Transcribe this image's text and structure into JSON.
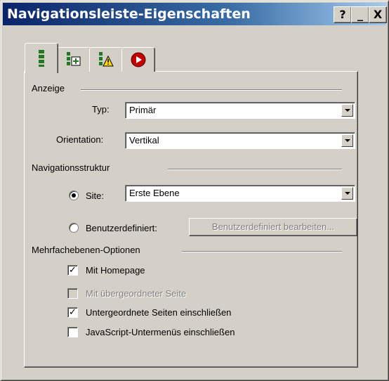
{
  "window": {
    "title": "Navigationsleiste-Eigenschaften",
    "buttons": {
      "help": "?",
      "minimize": "_",
      "close": "X"
    }
  },
  "tabs": [
    {
      "icon": "nav-bar-icon",
      "active": true
    },
    {
      "icon": "add-page-icon",
      "active": false
    },
    {
      "icon": "warning-page-icon",
      "active": false
    },
    {
      "icon": "red-circle-icon",
      "active": false
    }
  ],
  "anzeige": {
    "group_label": "Anzeige",
    "typ_label": "Typ:",
    "typ_value": "Primär",
    "orientation_label": "Orientation:",
    "orientation_value": "Vertikal"
  },
  "navigationsstruktur": {
    "group_label": "Navigationsstruktur",
    "site_label": "Site:",
    "site_value": "Erste Ebene",
    "custom_label": "Benutzerdefiniert:",
    "custom_button": "Benutzerdefiniert bearbeiten..."
  },
  "mehrfachebenen": {
    "group_label": "Mehrfachebenen-Optionen",
    "options": [
      {
        "label": "Mit Homepage",
        "checked": true,
        "enabled": true
      },
      {
        "label": "Mit übergeordneter Seite",
        "checked": false,
        "enabled": false
      },
      {
        "label": "Untergeordnete Seiten einschließen",
        "checked": true,
        "enabled": true
      },
      {
        "label": "JavaScript-Untermenüs einschließen",
        "checked": false,
        "enabled": true
      }
    ]
  },
  "colors": {
    "face": "#d4d0c8",
    "title_start": "#0a246a",
    "title_end": "#a6caf0"
  }
}
